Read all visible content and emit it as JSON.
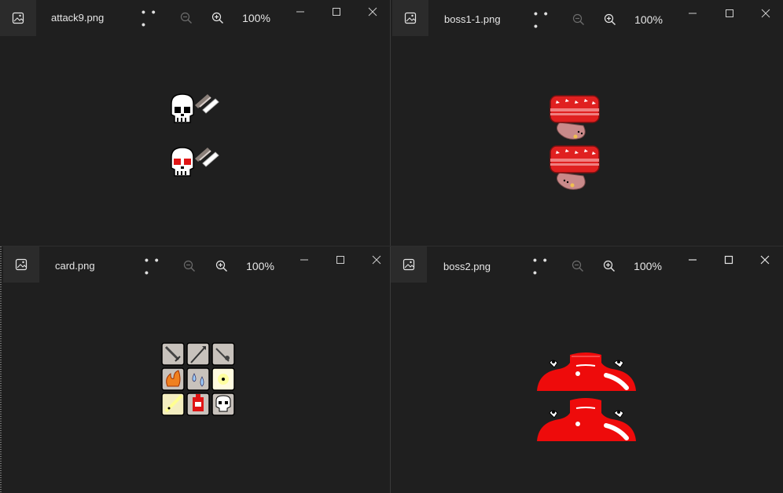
{
  "windows": [
    {
      "id": "w1",
      "filename": "attack9.png",
      "zoom": "100%"
    },
    {
      "id": "w2",
      "filename": "boss1-1.png",
      "zoom": "100%"
    },
    {
      "id": "w3",
      "filename": "card.png",
      "zoom": "100%"
    },
    {
      "id": "w4",
      "filename": "boss2.png",
      "zoom": "100%"
    }
  ],
  "toolbar": {
    "more_label": "• • •"
  },
  "icons": {
    "app": "photos-app-icon",
    "more": "more-options-icon",
    "zoom_out": "zoom-out-icon",
    "zoom_in": "zoom-in-icon",
    "minimize": "minimize-icon",
    "maximize": "maximize-icon",
    "close": "close-icon"
  },
  "colors": {
    "background": "#1f1f1f",
    "accent_red": "#e61010",
    "skull_white": "#ffffff"
  }
}
